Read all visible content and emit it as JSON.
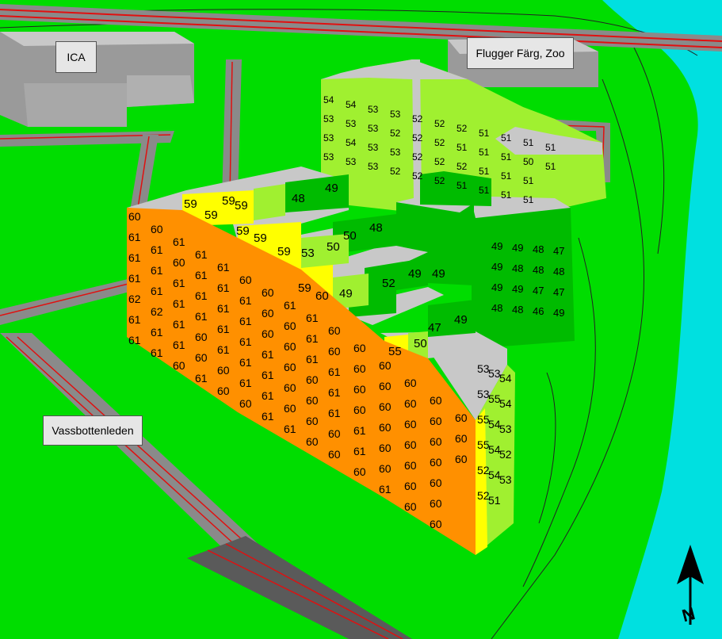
{
  "labels": {
    "ica": "ICA",
    "flugger": "Flugger Färg, Zoo",
    "road": "Vassbottenleden"
  },
  "colors": {
    "ground": "#00dd00",
    "water": "#00e0e0",
    "road": "#8f8f8f",
    "road_dark": "#5a5a5a",
    "road_line": "#e01010",
    "building_grey": "#bdbdbd",
    "roof": "#c8c8c8",
    "level_60_plus": "#ff9000",
    "level_55_59": "#ffff00",
    "level_50_54": "#a0f030",
    "level_45_49": "#00bb00"
  },
  "north_arrow": {
    "icon": "north-arrow-icon",
    "letter": "N"
  },
  "facade_values": {
    "orange_block": [
      "60",
      "61",
      "61",
      "61",
      "62",
      "61",
      "61",
      "60",
      "61",
      "61",
      "61",
      "62",
      "61",
      "61",
      "61",
      "60",
      "61",
      "61",
      "61",
      "61",
      "60",
      "61",
      "61",
      "61",
      "61",
      "60",
      "60",
      "61",
      "61",
      "61",
      "61",
      "61",
      "61",
      "60",
      "60",
      "60",
      "61",
      "61",
      "61",
      "61",
      "61",
      "60",
      "60",
      "60",
      "60",
      "61",
      "61",
      "61",
      "61",
      "61",
      "60",
      "60",
      "60",
      "60",
      "60",
      "61",
      "61",
      "61",
      "61",
      "60",
      "60",
      "60",
      "60",
      "60",
      "60",
      "61",
      "61",
      "61",
      "60",
      "60",
      "60",
      "60",
      "60",
      "60",
      "61",
      "61",
      "60",
      "60",
      "60",
      "60",
      "60",
      "60",
      "60",
      "61",
      "60",
      "60",
      "60",
      "60",
      "60",
      "60",
      "60",
      "60",
      "60",
      "60",
      "60",
      "60",
      "60",
      "60",
      "60",
      "60",
      "60"
    ],
    "stepped_roof_values": [
      "59",
      "59",
      "59",
      "59",
      "59",
      "59",
      "59",
      "53",
      "50",
      "48",
      "49",
      "50",
      "48",
      "49",
      "52",
      "49",
      "49",
      "55",
      "50",
      "47",
      "49",
      "59",
      "60"
    ],
    "light_green_block": [
      "54",
      "53",
      "53",
      "53",
      "54",
      "53",
      "54",
      "53",
      "53",
      "53",
      "53",
      "53",
      "53",
      "52",
      "53",
      "52",
      "52",
      "52",
      "52",
      "52",
      "52",
      "52",
      "52",
      "52",
      "52",
      "51",
      "52",
      "51",
      "51",
      "51",
      "51",
      "51",
      "51",
      "51",
      "51",
      "51",
      "51",
      "50",
      "51",
      "51",
      "51",
      "51"
    ],
    "dark_green_block": [
      "49",
      "49",
      "49",
      "48",
      "49",
      "48",
      "49",
      "48",
      "48",
      "48",
      "47",
      "46",
      "47",
      "48",
      "47",
      "49"
    ],
    "side_values": [
      "53",
      "53",
      "54",
      "53",
      "55",
      "54",
      "55",
      "54",
      "53",
      "55",
      "54",
      "52",
      "52",
      "54",
      "53",
      "52",
      "51"
    ]
  }
}
